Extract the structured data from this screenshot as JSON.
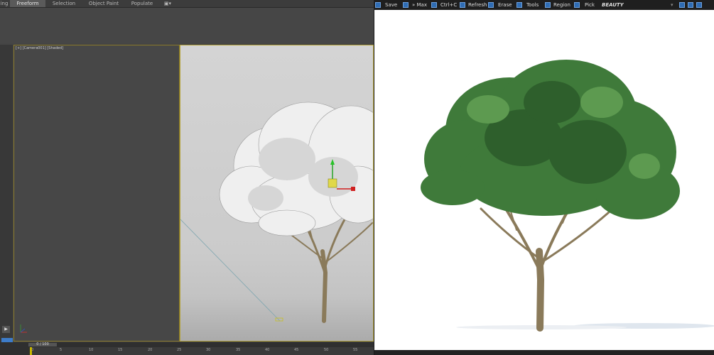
{
  "ribbon": {
    "tabs": [
      {
        "label": "ing",
        "active": false
      },
      {
        "label": "Freeform",
        "active": true
      },
      {
        "label": "Selection",
        "active": false
      },
      {
        "label": "Object Paint",
        "active": false
      },
      {
        "label": "Populate",
        "active": false
      }
    ]
  },
  "viewport": {
    "label": "[+] [Camera001] [Shaded]"
  },
  "timeline": {
    "counter": "0 / 100",
    "ticks": [
      "0",
      "5",
      "10",
      "15",
      "20",
      "25",
      "30",
      "35",
      "40",
      "45",
      "50",
      "55"
    ]
  },
  "vfb_toolbar": {
    "save": "Save",
    "max": "» Max",
    "copy": "Ctrl+C",
    "refresh": "Refresh",
    "erase": "Erase",
    "tools": "Tools",
    "region": "Region",
    "pick": "Pick",
    "channel": "BEAUTY"
  },
  "colors": {
    "accent_blue": "#2f6db5",
    "viewport_border": "#b3a23a",
    "foliage_green": "#3f7a3a",
    "trunk": "#8a7a5a"
  }
}
